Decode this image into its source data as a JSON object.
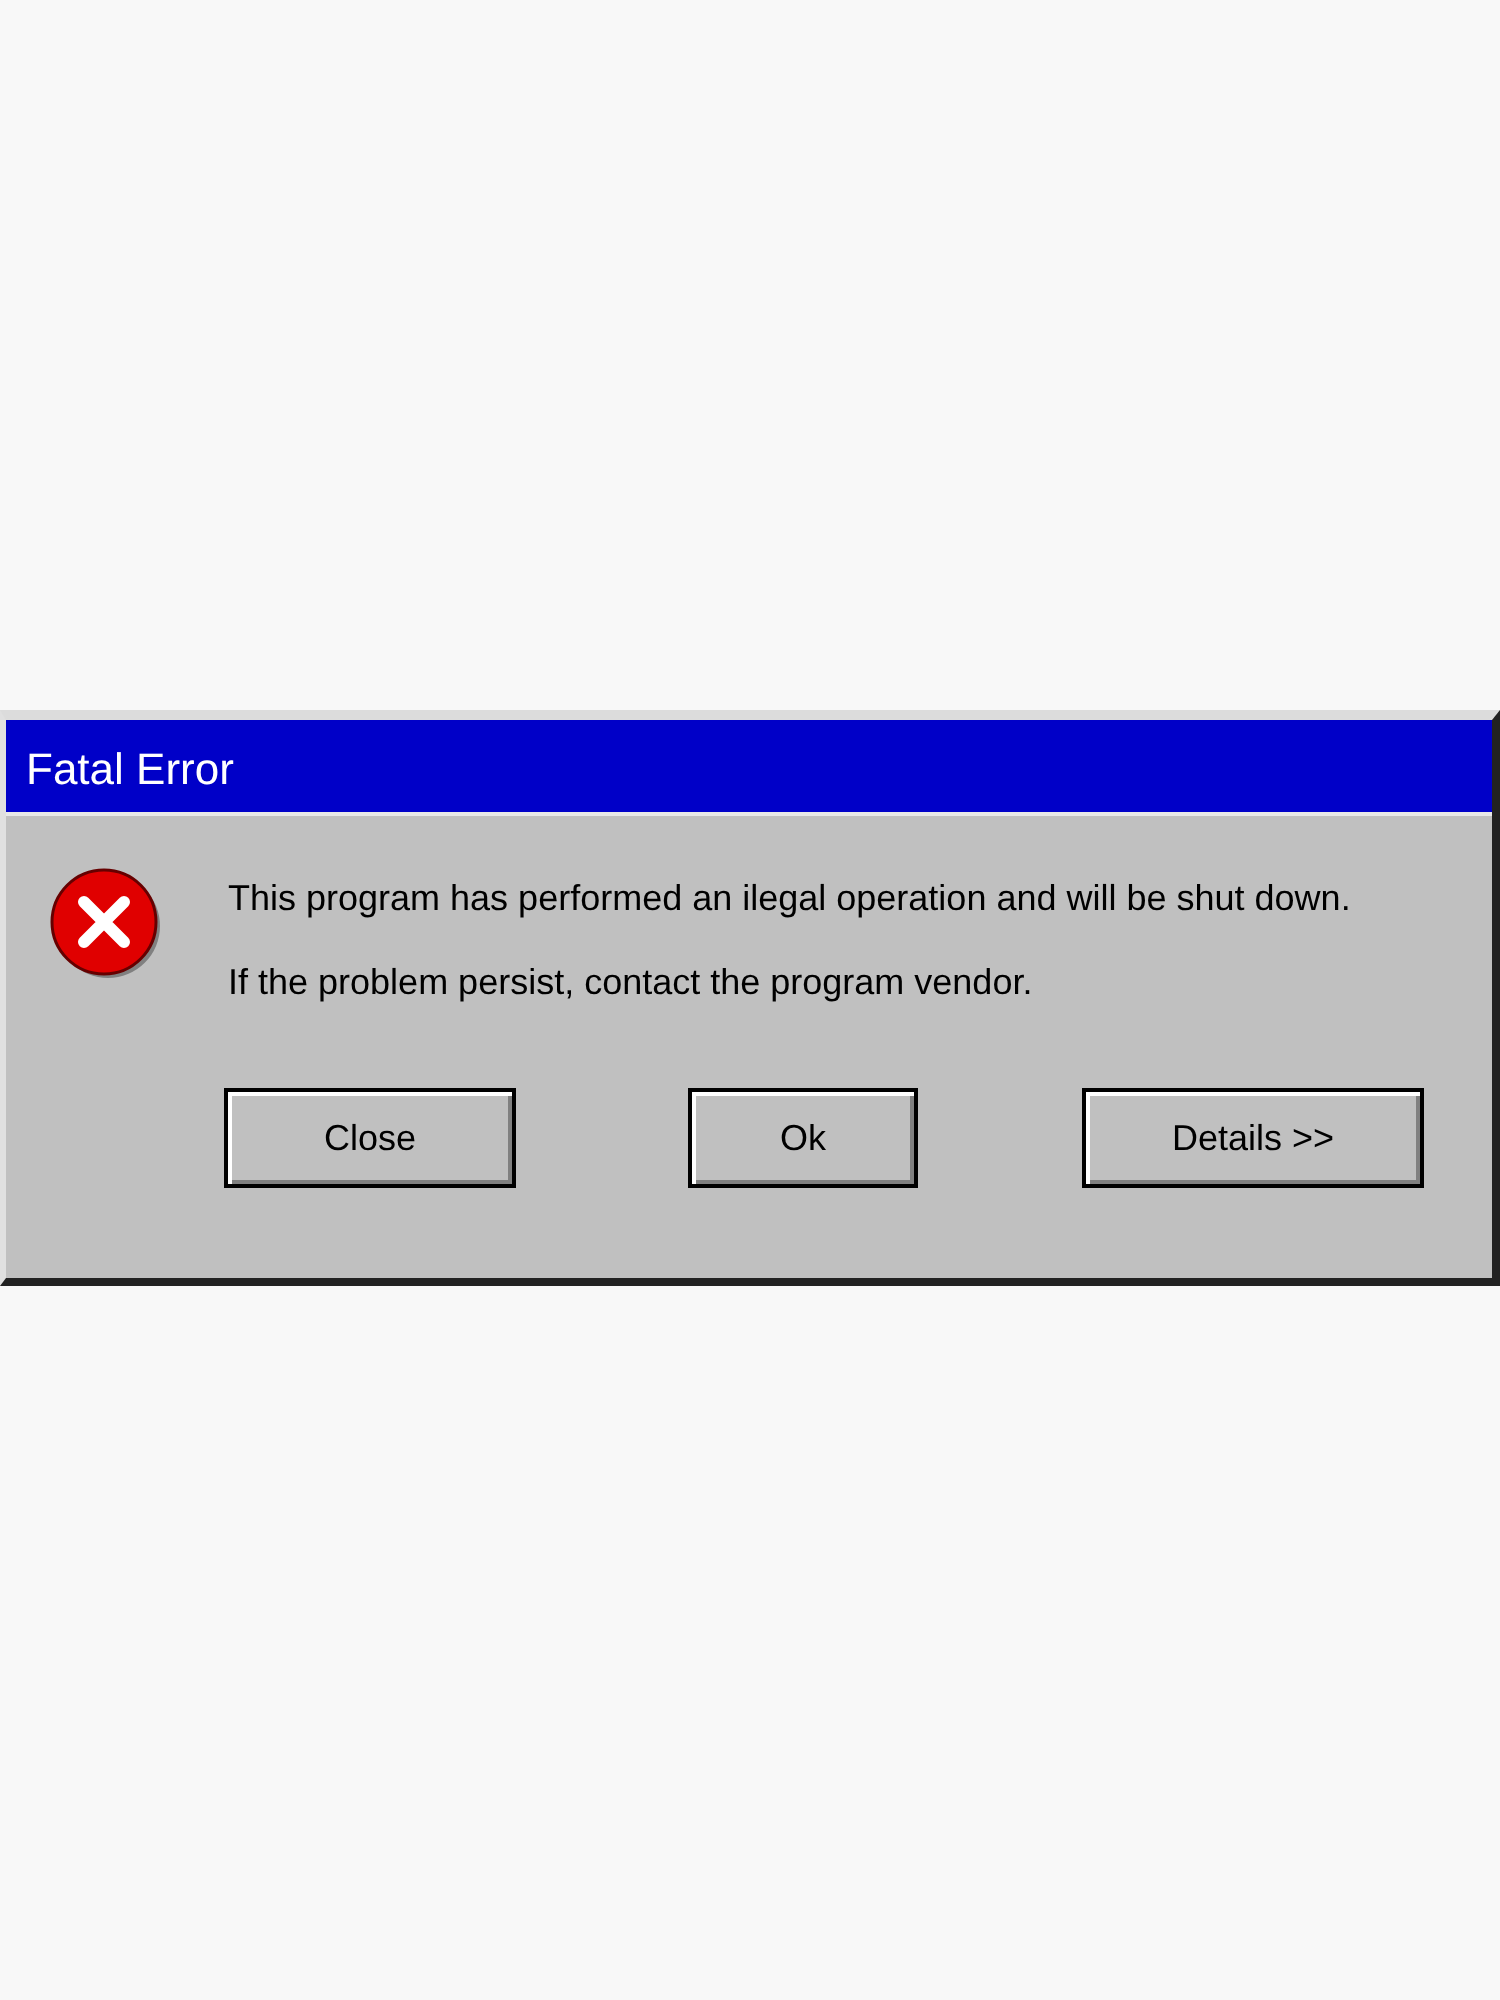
{
  "window": {
    "title": "Fatal Error"
  },
  "messages": [
    "This program has performed an ilegal operation and will be shut down.",
    "If the problem persist, contact the program vendor."
  ],
  "buttons": [
    "Close",
    "Ok",
    "Details >>"
  ]
}
